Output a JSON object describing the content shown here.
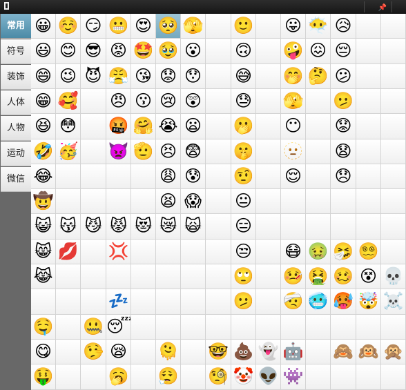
{
  "titlebar": {
    "pin_glyph": "📌"
  },
  "tabs": [
    "常用",
    "符号",
    "装饰",
    "人体",
    "人物",
    "运动",
    "微信"
  ],
  "active_tab": 0,
  "emoji_rows": [
    [
      "😀",
      "☺️",
      "😏",
      "😬",
      "😍",
      "🥺",
      "🫣",
      "",
      "🙂",
      "",
      "😛",
      "😶‍🌫️",
      "😥",
      "",
      ""
    ],
    [
      "😃",
      "😊",
      "😎",
      "😡",
      "🤩",
      "🥹",
      "😮",
      "",
      "🙃",
      "",
      "🤪",
      "😖",
      "😔",
      "",
      ""
    ],
    [
      "😄",
      "😉",
      "😈",
      "😤",
      "😘",
      "😟",
      "😯",
      "",
      "😅",
      "",
      "🤭",
      "🤔",
      "😕",
      "",
      ""
    ],
    [
      "😁",
      "🥰",
      "",
      "😠",
      "😗",
      "😢",
      "😲",
      "",
      "😓",
      "",
      "🫣",
      "",
      "🫤",
      "",
      ""
    ],
    [
      "😆",
      "😳",
      "",
      "🤬",
      "🤗",
      "😭",
      "😦",
      "",
      "🫢",
      "",
      "😶",
      "",
      "😟",
      "",
      ""
    ],
    [
      "🤣",
      "🥳",
      "",
      "👿",
      "🫡",
      "😣",
      "😨",
      "",
      "🤫",
      "",
      "🫥",
      "",
      "😧",
      "",
      ""
    ],
    [
      "😂",
      "",
      "",
      "",
      "",
      "😩",
      "😰",
      "",
      "🤨",
      "",
      "😌",
      "",
      "😞",
      "",
      ""
    ],
    [
      "🤠",
      "",
      "",
      "",
      "",
      "😫",
      "😱",
      "",
      "😐",
      "",
      "",
      "",
      "",
      "",
      ""
    ],
    [
      "😺",
      "😽",
      "😼",
      "😾",
      "😻",
      "😿",
      "🙀",
      "",
      "😑",
      "",
      "",
      "",
      "",
      "",
      ""
    ],
    [
      "😸",
      "💋",
      "",
      "💢",
      "",
      "",
      "",
      "",
      "😒",
      "",
      "😷",
      "🤢",
      "🤧",
      "😵‍💫",
      ""
    ],
    [
      "😹",
      "",
      "",
      "",
      "",
      "",
      "",
      "",
      "🙄",
      "",
      "🤒",
      "🤮",
      "🥴",
      "😵",
      "💀"
    ],
    [
      "",
      "",
      "",
      "💤",
      "",
      "",
      "",
      "",
      "🫤",
      "",
      "🤕",
      "🥶",
      "🥵",
      "🤯",
      "☠️"
    ],
    [
      "🤤",
      "",
      "🤐",
      "😴",
      "",
      "",
      "",
      "",
      "",
      "",
      "",
      "",
      "",
      "",
      ""
    ],
    [
      "😋",
      "",
      "🤥",
      "😪",
      "",
      "🫠",
      "",
      "🤓",
      "💩",
      "👻",
      "🤖",
      "",
      "🙈",
      "🙉",
      "🙊"
    ],
    [
      "🤑",
      "",
      "",
      "🥱",
      "",
      "😮‍💨",
      "",
      "🧐",
      "🤡",
      "👽",
      "👾",
      "",
      "",
      "",
      ""
    ]
  ],
  "highlight": {
    "row": 0,
    "col": 5
  }
}
